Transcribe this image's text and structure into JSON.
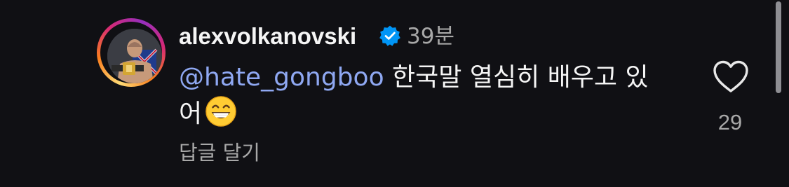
{
  "comment": {
    "username": "alexvolkanovski",
    "verified": true,
    "timestamp": "39분",
    "mention": "@hate_gongboo",
    "text": " 한국말 열심히 배우고 있어",
    "emoji": "grinning-face-with-smiling-eyes",
    "reply_label": "답글 달기",
    "like_count": "29",
    "liked": false
  },
  "colors": {
    "background": "#101014",
    "mention": "#8fa8f2",
    "verified_badge": "#0095f6",
    "secondary_text": "#a8a8a8"
  },
  "icons": {
    "verified": "verified-badge-icon",
    "like": "heart-outline-icon"
  }
}
